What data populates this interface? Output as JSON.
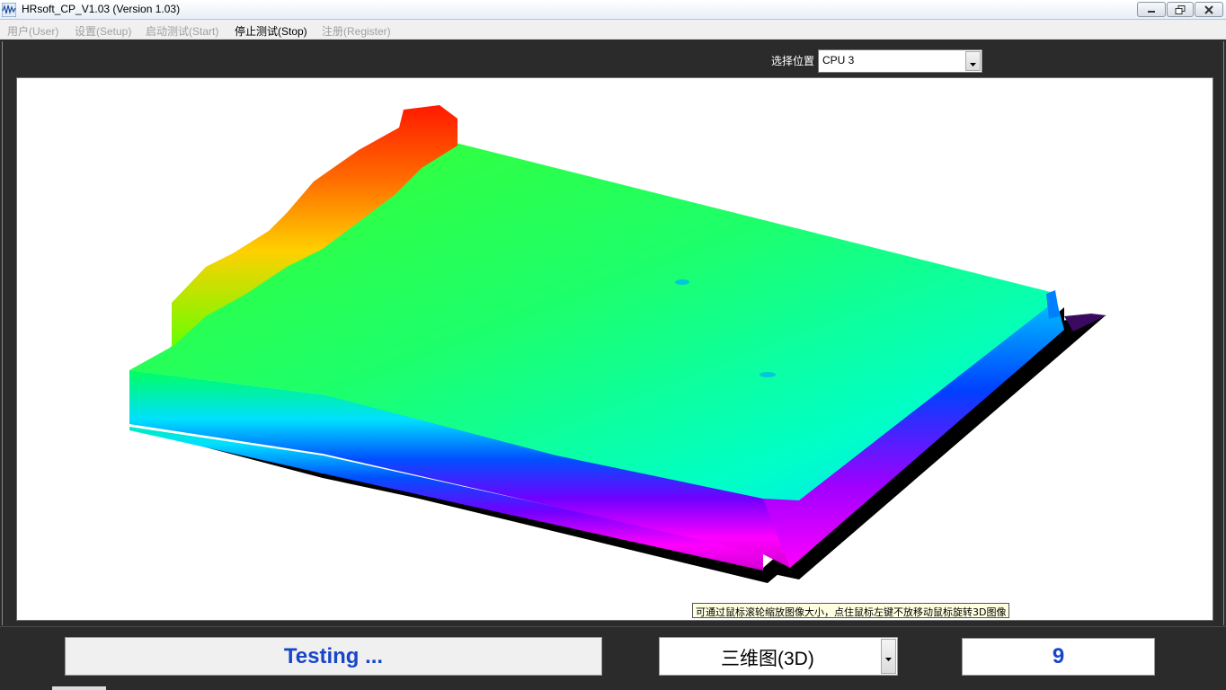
{
  "window": {
    "title": "HRsoft_CP_V1.03 (Version 1.03)",
    "icon": "app-waveform-icon",
    "controls": {
      "minimize": "minimize-icon",
      "restore": "restore-icon",
      "close": "close-icon"
    }
  },
  "menu": {
    "items": [
      {
        "label": "用户(User)",
        "enabled": false
      },
      {
        "label": "设置(Setup)",
        "enabled": false
      },
      {
        "label": "启动测试(Start)",
        "enabled": false
      },
      {
        "label": "停止测试(Stop)",
        "enabled": true
      },
      {
        "label": "注册(Register)",
        "enabled": false
      }
    ]
  },
  "location": {
    "label": "选择位置",
    "value": "CPU 3"
  },
  "viewer": {
    "tooltip": "可通过鼠标滚轮缩放图像大小，点住鼠标左键不放移动鼠标旋转3D图像",
    "colormap": [
      "#ff0000",
      "#ff8800",
      "#ffff00",
      "#00ff00",
      "#00ffcc",
      "#0088ff",
      "#0000ff",
      "#8800ff",
      "#ff00ff"
    ]
  },
  "status": {
    "text": "Testing ...",
    "view_mode": "三维图(3D)",
    "count": "9"
  },
  "colors": {
    "status_text": "#1846c8",
    "background": "#2b2b2b"
  }
}
